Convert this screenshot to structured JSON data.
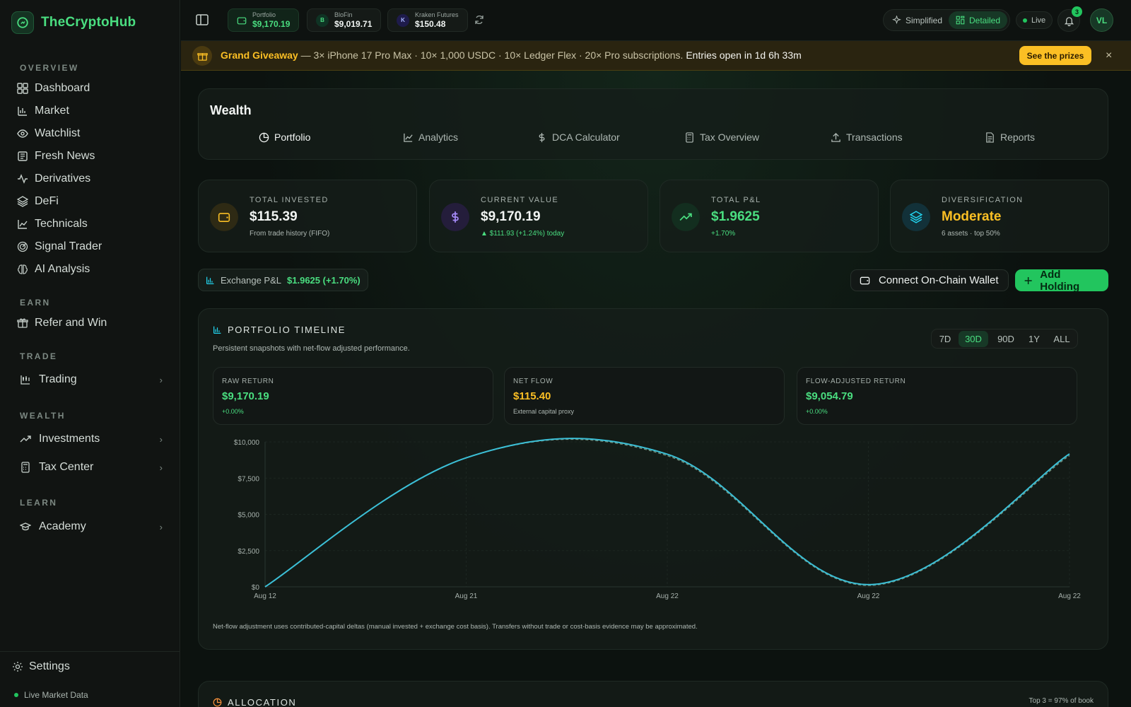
{
  "brand": {
    "name": "TheCryptoHub"
  },
  "sidebar": {
    "sections": {
      "overview": "OVERVIEW",
      "earn": "EARN",
      "trade": "TRADE",
      "wealth": "WEALTH",
      "learn": "LEARN"
    },
    "items": {
      "dashboard": "Dashboard",
      "market": "Market",
      "watchlist": "Watchlist",
      "fresh_news": "Fresh News",
      "derivatives": "Derivatives",
      "defi": "DeFi",
      "technicals": "Technicals",
      "signal_trader": "Signal Trader",
      "ai_analysis": "AI Analysis",
      "refer": "Refer and Win",
      "trading": "Trading",
      "investments": "Investments",
      "tax_center": "Tax Center",
      "academy": "Academy"
    },
    "settings": "Settings",
    "live_data": "Live Market Data"
  },
  "topbar": {
    "accounts": [
      {
        "label": "Portfolio",
        "value": "$9,170.19"
      },
      {
        "label": "BloFin",
        "value": "$9,019.71",
        "badge": "B"
      },
      {
        "label": "Kraken Futures",
        "value": "$150.48",
        "badge": "K"
      }
    ],
    "modes": {
      "simplified": "Simplified",
      "detailed": "Detailed",
      "active": "detailed"
    },
    "live": "Live",
    "notifications": "3",
    "avatar": "VL"
  },
  "banner": {
    "title": "Grand Giveaway",
    "text": "— 3× iPhone 17 Pro Max · 10× 1,000 USDC · 10× Ledger Flex · 20× Pro subscriptions.",
    "countdown": "Entries open in 1d 6h 33m",
    "button": "See the prizes",
    "close": "×"
  },
  "wealth": {
    "title": "Wealth",
    "tabs": [
      "Portfolio",
      "Analytics",
      "DCA Calculator",
      "Tax Overview",
      "Transactions",
      "Reports"
    ],
    "active_tab": "Portfolio"
  },
  "stats": [
    {
      "label": "TOTAL INVESTED",
      "value": "$115.39",
      "sub": "From trade history (FIFO)",
      "icon": "wallet-icon",
      "color": "#fbbf24"
    },
    {
      "label": "CURRENT VALUE",
      "value": "$9,170.19",
      "sub": "▲ $111.93 (+1.24%) today",
      "icon": "dollar-icon",
      "color": "#a78bfa"
    },
    {
      "label": "TOTAL P&L",
      "value": "$1.9625",
      "sub": "+1.70%",
      "icon": "trend-up-icon",
      "color": "#4ade80"
    },
    {
      "label": "DIVERSIFICATION",
      "value": "Moderate",
      "sub": "6 assets · top 50%",
      "icon": "layers-icon",
      "color": "#22d3ee"
    }
  ],
  "exchange_pnl": {
    "label": "Exchange P&L",
    "value": "$1.9625 (+1.70%)"
  },
  "actions": {
    "connect_wallet": "Connect On-Chain Wallet",
    "add_holding": "Add Holding"
  },
  "timeline": {
    "title": "PORTFOLIO TIMELINE",
    "subtitle": "Persistent snapshots with net-flow adjusted performance.",
    "ranges": [
      "7D",
      "30D",
      "90D",
      "1Y",
      "ALL"
    ],
    "active_range": "30D",
    "metrics": [
      {
        "label": "RAW RETURN",
        "value": "$9,170.19",
        "sub": "+0.00%",
        "color": "#4ade80"
      },
      {
        "label": "NET FLOW",
        "value": "$115.40",
        "sub": "External capital proxy",
        "color": "#fbbf24"
      },
      {
        "label": "FLOW-ADJUSTED RETURN",
        "value": "$9,054.79",
        "sub": "+0.00%",
        "color": "#4ade80"
      }
    ],
    "footnote": "Net-flow adjustment uses contributed-capital deltas (manual invested + exchange cost basis). Transfers without trade or cost-basis evidence may be approximated."
  },
  "chart_data": {
    "type": "line",
    "title": "",
    "xlabel": "",
    "ylabel": "",
    "ylim": [
      0,
      10000
    ],
    "yticks": [
      "$0",
      "$2,500",
      "$5,000",
      "$7,500",
      "$10,000"
    ],
    "ytick_values": [
      0,
      2500,
      5000,
      7500,
      10000
    ],
    "x_tick_labels": [
      "Aug 12",
      "Aug 21",
      "Aug 22",
      "Aug 22",
      "Aug 22"
    ],
    "x": [
      0,
      0.25,
      0.5,
      0.75,
      1
    ],
    "grid": true,
    "series": [
      {
        "name": "",
        "values": [
          0,
          8900,
          9150,
          150,
          9170
        ],
        "color": "#3bbfd6",
        "style": "solid"
      },
      {
        "name": "",
        "values": [
          0,
          8900,
          9050,
          100,
          9055
        ],
        "color": "#6e8f7d",
        "style": "dashed"
      }
    ]
  },
  "allocation": {
    "title": "ALLOCATION",
    "right": "Top 3 = 97% of book"
  }
}
